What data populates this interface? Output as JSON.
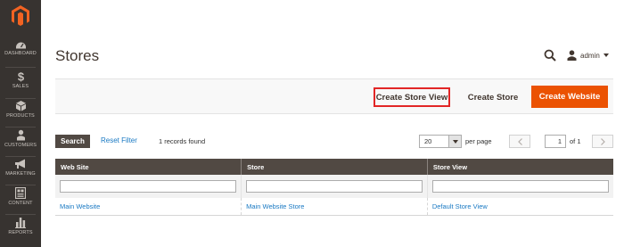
{
  "page": {
    "title": "Stores"
  },
  "header": {
    "user_name": "admin"
  },
  "sidebar": {
    "items": [
      {
        "label": "DASHBOARD",
        "icon": "dashboard-icon"
      },
      {
        "label": "SALES",
        "icon": "dollar-icon"
      },
      {
        "label": "PRODUCTS",
        "icon": "cube-icon"
      },
      {
        "label": "CUSTOMERS",
        "icon": "customers-icon"
      },
      {
        "label": "MARKETING",
        "icon": "megaphone-icon"
      },
      {
        "label": "CONTENT",
        "icon": "content-icon"
      },
      {
        "label": "REPORTS",
        "icon": "bar-chart-icon"
      }
    ]
  },
  "actions": {
    "create_store_view": "Create Store View",
    "create_store": "Create Store",
    "create_website": "Create Website"
  },
  "grid": {
    "search_label": "Search",
    "reset_filter_label": "Reset Filter",
    "records_found": "1 records found",
    "per_page_value": "20",
    "per_page_label": "per page",
    "current_page": "1",
    "page_of": "of 1",
    "columns": [
      "Web Site",
      "Store",
      "Store View"
    ],
    "rows": [
      {
        "website": "Main Website",
        "store": "Main Website Store",
        "store_view": "Default Store View"
      }
    ]
  },
  "colors": {
    "sidebar_bg": "#373330",
    "accent_orange": "#eb5202",
    "highlight_red": "#e22626",
    "table_header_bg": "#514943",
    "link_blue": "#1979c3"
  }
}
